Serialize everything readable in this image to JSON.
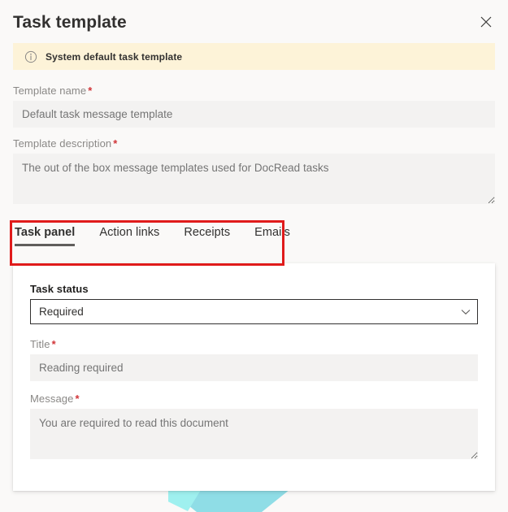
{
  "dialog": {
    "title": "Task template",
    "close_icon": "close-icon",
    "close_label": "Close"
  },
  "banner": {
    "icon": "info-circle-icon",
    "text": "System default task template",
    "background_color": "#fdf3d8"
  },
  "form": {
    "template_name": {
      "label": "Template name",
      "required_marker": "*",
      "value": "Default task message template",
      "placeholder": "Default task message template"
    },
    "template_description": {
      "label": "Template description",
      "required_marker": "*",
      "value": "The out of the box message templates used for DocRead tasks",
      "placeholder": "The out of the box message templates used for DocRead tasks"
    }
  },
  "tabs": {
    "items": [
      {
        "label": "Task panel",
        "active": true
      },
      {
        "label": "Action links",
        "active": false
      },
      {
        "label": "Receipts",
        "active": false
      },
      {
        "label": "Emails",
        "active": false
      }
    ],
    "highlight_color": "#e01b1b"
  },
  "panel": {
    "task_status": {
      "label": "Task status",
      "selected": "Required",
      "chevron_icon": "chevron-down-icon"
    },
    "title": {
      "label": "Title",
      "required_marker": "*",
      "value": "Reading required",
      "placeholder": "Reading required"
    },
    "message": {
      "label": "Message",
      "required_marker": "*",
      "value": "You are required to read this document",
      "placeholder": "You are required to read this document"
    }
  },
  "theme": {
    "page_background": "#faf9f8",
    "panel_background": "#ffffff",
    "input_background": "#f3f2f1",
    "required_color": "#d13438",
    "accent_decor": "#9fe1e7"
  }
}
